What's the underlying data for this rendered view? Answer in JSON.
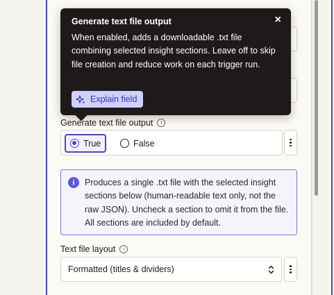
{
  "tooltip": {
    "title": "Generate text file output",
    "body": "When enabled, adds a downloadable .txt file combining selected insight sections. Leave off to skip file creation and reduce work on each trigger run.",
    "explain_label": "Explain field",
    "close_glyph": "×"
  },
  "generate_text_file": {
    "label": "Generate text file output",
    "options": [
      {
        "label": "True",
        "selected": true
      },
      {
        "label": "False",
        "selected": false
      }
    ]
  },
  "notice": {
    "text": "Produces a single .txt file with the selected insight sections below (human-readable text only, not the raw JSON). Uncheck a section to omit it from the file. All sections are included by default."
  },
  "text_file_layout": {
    "label": "Text file layout",
    "value": "Formatted (titles & dividers)"
  },
  "colors": {
    "accent": "#4b47b8",
    "tooltip_bg": "#1f1a19",
    "notice_border": "#7b78e0",
    "explain_bg": "#cfd0fb"
  }
}
